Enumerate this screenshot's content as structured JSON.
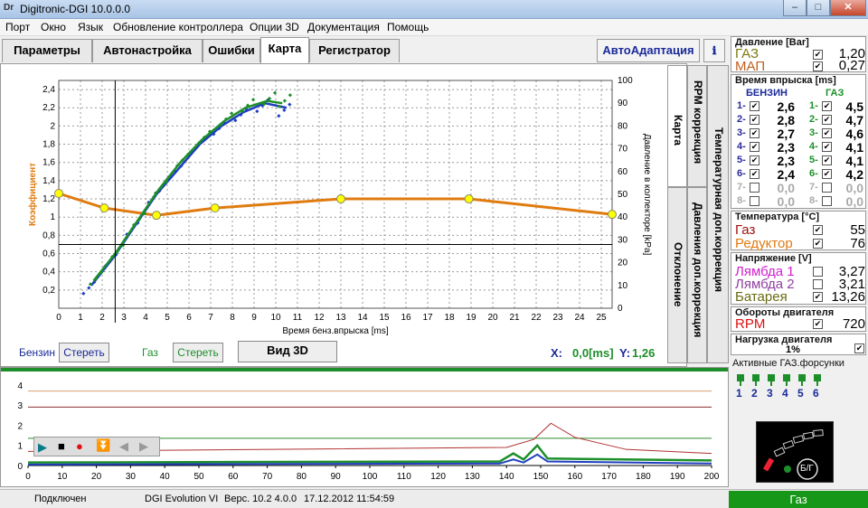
{
  "window": {
    "title": "Digitronic-DGI  10.0.0.0",
    "icon": "Dr"
  },
  "menu": [
    "Порт",
    "Окно",
    "Язык",
    "Обновление контроллера",
    "Опции 3D",
    "Документация",
    "Помощь"
  ],
  "tabs": [
    "Параметры",
    "Автонастройка",
    "Ошибки",
    "Карта",
    "Регистратор"
  ],
  "auto_adapt": "АвтоАдаптация",
  "help_icon": "ℹ",
  "vertical_tabs": [
    "Карта",
    "RPM коррекция",
    "Температурная доп.коррекция",
    "Давления доп.коррекция",
    "Отклонение"
  ],
  "chart": {
    "ylabel_left": "Коэффициент",
    "ylabel_right": "Давление в коллекторе [kPa]",
    "xlabel": "Время бенз.впрыска [ms]",
    "x_ticks": [
      "0",
      "1",
      "2",
      "3",
      "4",
      "5",
      "6",
      "7",
      "8",
      "9",
      "10",
      "11",
      "12",
      "13",
      "14",
      "15",
      "16",
      "17",
      "18",
      "19",
      "20",
      "21",
      "22",
      "23",
      "24",
      "25"
    ],
    "y_left_ticks": [
      "0,2",
      "0,4",
      "0,6",
      "0,8",
      "1",
      "1,2",
      "1,4",
      "1,6",
      "1,8",
      "2",
      "2,2",
      "2,4"
    ],
    "y_right_ticks": [
      "0",
      "10",
      "20",
      "30",
      "40",
      "50",
      "60",
      "70",
      "80",
      "90",
      "100"
    ]
  },
  "chart_data": {
    "type": "line",
    "xlim": [
      0,
      25.5
    ],
    "ylim_left": [
      0,
      2.5
    ],
    "ylim_right": [
      0,
      100
    ],
    "series": [
      {
        "name": "",
        "color": "#e07b10",
        "axis": "left",
        "x": [
          0,
          2.1,
          4.5,
          7.2,
          13,
          18.9,
          25.5
        ],
        "y": [
          1.26,
          1.1,
          1.02,
          1.1,
          1.2,
          1.2,
          1.03
        ]
      },
      {
        "name": "",
        "color": "#1f3fbf",
        "axis": "right",
        "x": [
          1.5,
          2.5,
          3.5,
          4.5,
          5.5,
          6.5,
          7.5,
          8.5,
          9.5,
          10.5
        ],
        "y": [
          10,
          22,
          36,
          50,
          61,
          72,
          80,
          86,
          90,
          88
        ]
      },
      {
        "name": "",
        "color": "#1d8f2a",
        "axis": "right",
        "x": [
          1.6,
          2.6,
          3.6,
          4.6,
          5.6,
          6.6,
          7.6,
          8.6,
          9.6,
          10.3
        ],
        "y": [
          12,
          24,
          38,
          52,
          64,
          74,
          82,
          88,
          91,
          90
        ]
      }
    ],
    "cursor": {
      "x": 2.6,
      "y": 0.7
    }
  },
  "bottom": {
    "benzin": "Бензин",
    "clear1": "Стереть",
    "gas": "Газ",
    "clear2": "Стереть",
    "view3d": "Вид 3D",
    "xlabel": "X:",
    "xval": "0,0[ms]",
    "ylabel": "Y:",
    "yval": "1,26"
  },
  "strip": {
    "y_ticks": [
      "0",
      "1",
      "2",
      "3",
      "4"
    ],
    "x_ticks": [
      "0",
      "10",
      "20",
      "30",
      "40",
      "50",
      "60",
      "70",
      "80",
      "90",
      "100",
      "110",
      "120",
      "130",
      "140",
      "150",
      "160",
      "170",
      "180",
      "190",
      "200"
    ]
  },
  "status": {
    "conn": "Подключен",
    "device": "DGI Evolution VI",
    "version": "Верс. 10.2  4.0.0",
    "datetime": "17.12.2012 11:54:59",
    "mode": "Газ"
  },
  "right": {
    "pressure": {
      "title": "Давление [Bar]",
      "gas_label": "ГАЗ",
      "gas_val": "1,20",
      "map_label": "МАП",
      "map_val": "0,27"
    },
    "inj": {
      "title": "Время впрыска [ms]",
      "benzin": "БЕНЗИН",
      "gas": "ГАЗ",
      "rows": [
        {
          "n": "1-",
          "b": "2,6",
          "g": "4,5",
          "on": true
        },
        {
          "n": "2-",
          "b": "2,8",
          "g": "4,7",
          "on": true
        },
        {
          "n": "3-",
          "b": "2,7",
          "g": "4,6",
          "on": true
        },
        {
          "n": "4-",
          "b": "2,3",
          "g": "4,1",
          "on": true
        },
        {
          "n": "5-",
          "b": "2,3",
          "g": "4,1",
          "on": true
        },
        {
          "n": "6-",
          "b": "2,4",
          "g": "4,2",
          "on": true
        },
        {
          "n": "7-",
          "b": "0,0",
          "g": "0,0",
          "on": false
        },
        {
          "n": "8-",
          "b": "0,0",
          "g": "0,0",
          "on": false
        }
      ]
    },
    "temp": {
      "title": "Температура [°C]",
      "gas_label": "Газ",
      "gas_val": "55",
      "red_label": "Редуктор",
      "red_val": "76"
    },
    "volt": {
      "title": "Напряжение [V]",
      "l1": "Лямбда 1",
      "v1": "3,27",
      "l2": "Лямбда 2",
      "v2": "3,21",
      "l3": "Батарея",
      "v3": "13,26"
    },
    "rpm": {
      "title": "Обороты двигателя",
      "label": "RPM",
      "val": "720"
    },
    "load": {
      "title": "Нагрузка двигателя",
      "val": "1%"
    },
    "active": {
      "title": "Активные ГАЗ.форсунки",
      "nums": [
        "1",
        "2",
        "3",
        "4",
        "5",
        "6"
      ]
    },
    "gauge_label": "Б/Г"
  }
}
